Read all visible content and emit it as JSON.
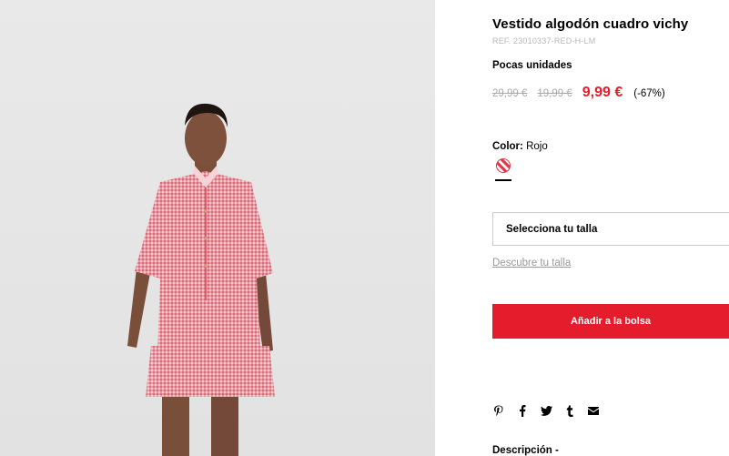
{
  "product": {
    "title": "Vestido algodón cuadro vichy",
    "ref": "REF. 23010337-RED-H-LM",
    "stock_note": "Pocas unidades",
    "prices": {
      "original": "29,99 €",
      "previous": "19,99 €",
      "current": "9,99 €",
      "discount": "(-67%)"
    },
    "color": {
      "label": "Color:",
      "value": "Rojo",
      "swatch_color": "#e23a4b"
    },
    "size_select": "Selecciona tu talla",
    "size_guide_link": "Descubre tu talla",
    "add_to_bag": "Añadir a la bolsa",
    "share_icons": [
      "pinterest-icon",
      "facebook-icon",
      "twitter-icon",
      "tumblr-icon",
      "email-icon"
    ],
    "description_heading": "Descripción -"
  },
  "colors": {
    "accent": "#e51c2c",
    "muted": "#aaaaaa"
  }
}
